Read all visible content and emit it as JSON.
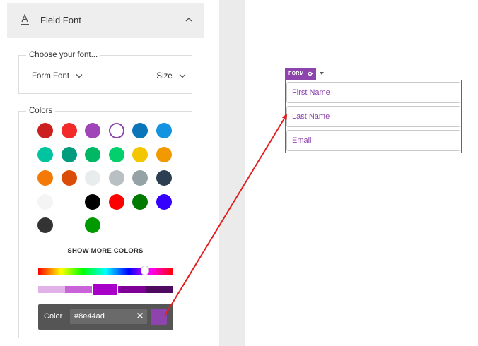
{
  "panel": {
    "section_title": "Field Font",
    "font_group_label": "Choose your font...",
    "font_select_value": "Form Font",
    "size_select_value": "Size",
    "colors_group_label": "Colors",
    "show_more_label": "SHOW MORE COLORS",
    "color_label": "Color",
    "color_hex_value": "#8e44ad",
    "selected_color": "#8e44ad"
  },
  "swatches": [
    "#cc1f1f",
    "#f22a2a",
    "#9f45b8",
    "#8e44ad",
    "#0a75b8",
    "#1493e0",
    "#00c49f",
    "#019b7e",
    "#00b864",
    "#04cf6d",
    "#f2c600",
    "#f29900",
    "#f47a08",
    "#d94d08",
    "#e8eced",
    "#b9c0c4",
    "#95a3a6",
    "#2c3f52",
    "#f4f4f4",
    "#000000",
    "#ff0000",
    "#007b00",
    "#3300ff",
    "#333333",
    "#009900"
  ],
  "shades": [
    "#e1b2e8",
    "#c864d8",
    "#a800c8",
    "#7e0096",
    "#4e0a5e"
  ],
  "canvas": {
    "form_tab_label": "FORM",
    "fields": [
      "First Name",
      "Last Name",
      "Email"
    ]
  },
  "colors": {
    "accent": "#8e44ad",
    "arrow": "#e02020",
    "panel_header_bg": "#eeeeee"
  }
}
